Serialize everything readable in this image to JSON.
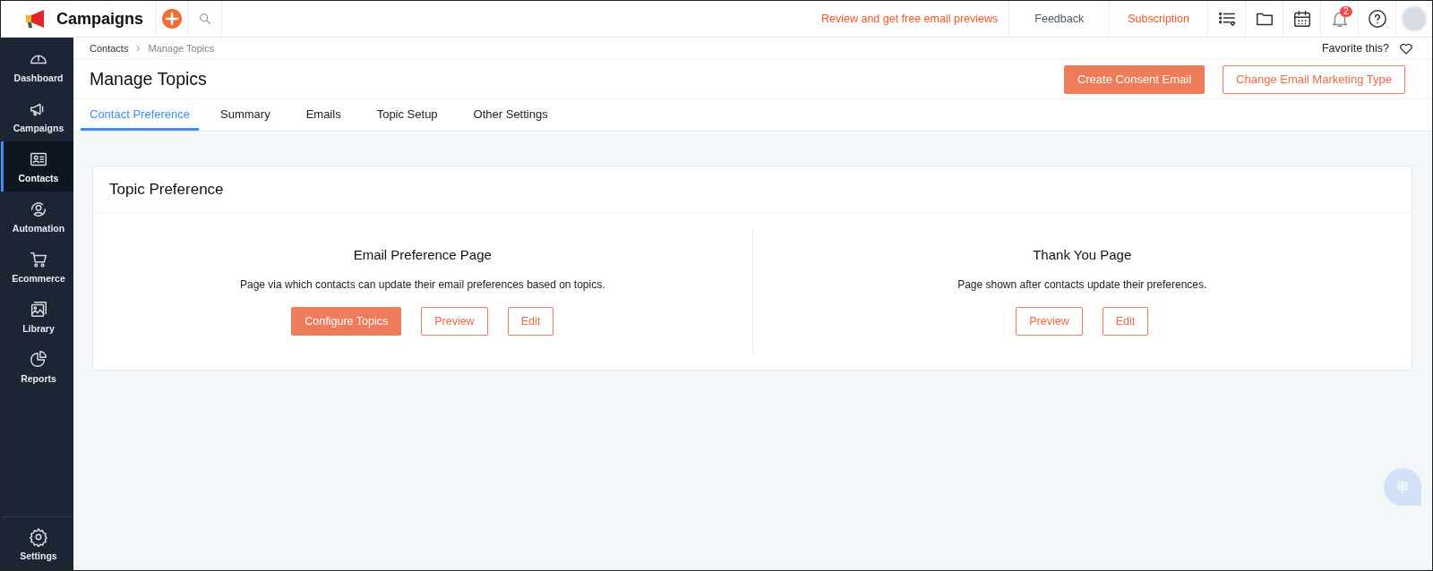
{
  "app": {
    "title": "Campaigns"
  },
  "topbar": {
    "links": [
      {
        "label": "Review and get free email previews",
        "kind": "promo"
      },
      {
        "label": "Feedback",
        "kind": "plain"
      },
      {
        "label": "Subscription",
        "kind": "promo"
      }
    ],
    "notification_count": "2"
  },
  "sidebar": {
    "items": [
      {
        "label": "Dashboard",
        "selected": false
      },
      {
        "label": "Campaigns",
        "selected": false
      },
      {
        "label": "Contacts",
        "selected": true
      },
      {
        "label": "Automation",
        "selected": false
      },
      {
        "label": "Ecommerce",
        "selected": false
      },
      {
        "label": "Library",
        "selected": false
      },
      {
        "label": "Reports",
        "selected": false
      }
    ],
    "footer": {
      "label": "Settings"
    }
  },
  "breadcrumb": [
    "Contacts",
    "Manage Topics"
  ],
  "favorite": {
    "label": "Favorite this?"
  },
  "page": {
    "title": "Manage Topics",
    "actions": [
      {
        "label": "Create Consent Email",
        "kind": "primary"
      },
      {
        "label": "Change Email Marketing Type",
        "kind": "outline"
      }
    ]
  },
  "tabs": [
    {
      "label": "Contact Preference",
      "selected": true
    },
    {
      "label": "Summary",
      "selected": false
    },
    {
      "label": "Emails",
      "selected": false
    },
    {
      "label": "Topic Setup",
      "selected": false
    },
    {
      "label": "Other Settings",
      "selected": false
    }
  ],
  "card": {
    "title": "Topic Preference",
    "sections": [
      {
        "title": "Email Preference Page",
        "description": "Page via which contacts can update their email preferences based on topics.",
        "buttons": [
          {
            "label": "Configure Topics",
            "kind": "primary"
          },
          {
            "label": "Preview",
            "kind": "outline"
          },
          {
            "label": "Edit",
            "kind": "outline"
          }
        ]
      },
      {
        "title": "Thank You Page",
        "description": "Page shown after contacts update their preferences.",
        "buttons": [
          {
            "label": "Preview",
            "kind": "outline"
          },
          {
            "label": "Edit",
            "kind": "outline"
          }
        ]
      }
    ]
  }
}
